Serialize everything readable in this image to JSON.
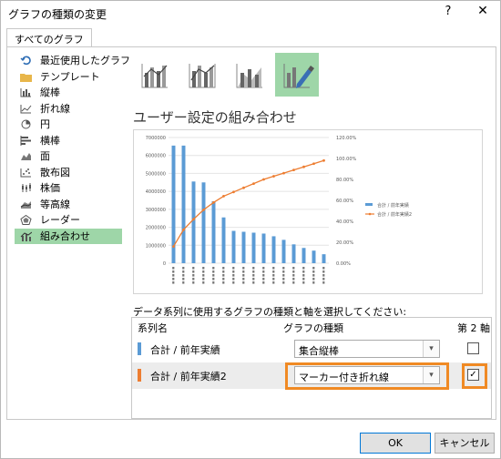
{
  "window": {
    "title": "グラフの種類の変更",
    "help": "?",
    "close": "✕"
  },
  "tabs": [
    {
      "label": "すべてのグラフ"
    }
  ],
  "sidebar": {
    "items": [
      {
        "label": "最近使用したグラフ",
        "icon": "recent-icon"
      },
      {
        "label": "テンプレート",
        "icon": "folder-icon"
      },
      {
        "label": "縦棒",
        "icon": "column-chart-icon"
      },
      {
        "label": "折れ線",
        "icon": "line-chart-icon"
      },
      {
        "label": "円",
        "icon": "pie-chart-icon"
      },
      {
        "label": "横棒",
        "icon": "bar-chart-icon"
      },
      {
        "label": "面",
        "icon": "area-chart-icon"
      },
      {
        "label": "散布図",
        "icon": "scatter-chart-icon"
      },
      {
        "label": "株価",
        "icon": "stock-chart-icon"
      },
      {
        "label": "等高線",
        "icon": "surface-chart-icon"
      },
      {
        "label": "レーダー",
        "icon": "radar-chart-icon"
      },
      {
        "label": "組み合わせ",
        "icon": "combo-chart-icon",
        "selected": true
      }
    ]
  },
  "combo_types": [
    "clustered-column-line-icon",
    "clustered-column-line-secondary-icon",
    "stacked-area-column-icon",
    "custom-combination-icon"
  ],
  "main": {
    "heading": "ユーザー設定の組み合わせ",
    "series_caption": "データ系列に使用するグラフの種類と軸を選択してください:",
    "columns": {
      "name": "系列名",
      "type": "グラフの種類",
      "secondary": "第 2 軸"
    }
  },
  "series_rows": [
    {
      "name": "合計 / 前年実績",
      "color": "#5b9bd5",
      "chart_type": "集合縦棒",
      "secondary": false,
      "check": ""
    },
    {
      "name": "合計 / 前年実績2",
      "color": "#ed7d31",
      "chart_type": "マーカー付き折れ線",
      "secondary": true,
      "check": "✓"
    }
  ],
  "chart_data": {
    "type": "bar",
    "title": "",
    "categories": [
      "",
      "",
      "",
      "",
      "",
      "",
      "",
      "",
      "",
      "",
      "",
      "",
      "",
      "",
      "",
      ""
    ],
    "y_ticks": [
      "7000000",
      "6000000",
      "5000000",
      "4000000",
      "3000000",
      "2000000",
      "1000000",
      "0"
    ],
    "y2_ticks": [
      "120.00%",
      "100.00%",
      "80.00%",
      "60.00%",
      "40.00%",
      "20.00%",
      "0.00%"
    ],
    "ylim": [
      0,
      7000000
    ],
    "y2lim": [
      0,
      1.2
    ],
    "series": [
      {
        "name": "合計 / 前年実績",
        "type": "bar",
        "color": "#5b9bd5",
        "values": [
          6550000,
          6550000,
          4550000,
          4500000,
          3450000,
          2550000,
          1800000,
          1750000,
          1700000,
          1650000,
          1500000,
          1300000,
          1050000,
          850000,
          700000,
          500000
        ]
      },
      {
        "name": "合計 / 前年実績2",
        "type": "line",
        "color": "#ed7d31",
        "values": [
          0.16,
          0.32,
          0.42,
          0.51,
          0.58,
          0.64,
          0.68,
          0.72,
          0.76,
          0.8,
          0.83,
          0.86,
          0.89,
          0.92,
          0.95,
          0.98
        ]
      }
    ],
    "legend": [
      "合計 / 前年実績",
      "合計 / 前年実績2"
    ],
    "legend_position": "right"
  },
  "buttons": {
    "ok": "OK",
    "cancel": "キャンセル"
  },
  "accent": "#f08a24"
}
